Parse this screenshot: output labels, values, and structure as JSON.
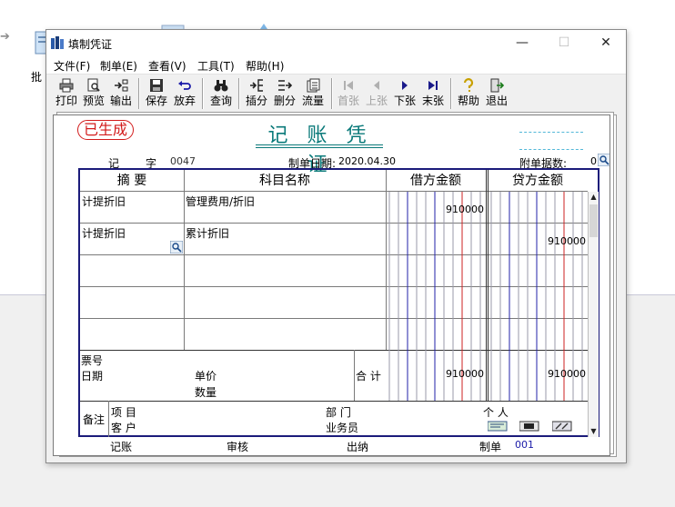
{
  "desktop": {
    "side_label": "批"
  },
  "window": {
    "title": "填制凭证",
    "controls": {
      "minimize": "—",
      "maximize": "☐",
      "close": "✕"
    }
  },
  "menu": [
    {
      "id": "file",
      "label": "文件(F)"
    },
    {
      "id": "make",
      "label": "制单(E)"
    },
    {
      "id": "view",
      "label": "查看(V)"
    },
    {
      "id": "tools",
      "label": "工具(T)"
    },
    {
      "id": "help",
      "label": "帮助(H)"
    }
  ],
  "toolbar": [
    {
      "id": "print",
      "label": "打印",
      "icon": "printer-icon",
      "enabled": true
    },
    {
      "id": "preview",
      "label": "预览",
      "icon": "preview-icon",
      "enabled": true
    },
    {
      "id": "export",
      "label": "输出",
      "icon": "export-icon",
      "enabled": true
    },
    {
      "id": "save",
      "label": "保存",
      "icon": "save-icon",
      "enabled": true
    },
    {
      "id": "discard",
      "label": "放弃",
      "icon": "undo-icon",
      "enabled": true
    },
    {
      "id": "query",
      "label": "查询",
      "icon": "binoculars-icon",
      "enabled": true
    },
    {
      "id": "insert",
      "label": "插分",
      "icon": "insert-row-icon",
      "enabled": true
    },
    {
      "id": "delete",
      "label": "删分",
      "icon": "delete-row-icon",
      "enabled": true
    },
    {
      "id": "flow",
      "label": "流量",
      "icon": "flow-icon",
      "enabled": true
    },
    {
      "id": "first",
      "label": "首张",
      "icon": "first-icon",
      "enabled": false
    },
    {
      "id": "prev",
      "label": "上张",
      "icon": "prev-icon",
      "enabled": false
    },
    {
      "id": "next",
      "label": "下张",
      "icon": "next-icon",
      "enabled": true
    },
    {
      "id": "last",
      "label": "末张",
      "icon": "last-icon",
      "enabled": true
    },
    {
      "id": "help",
      "label": "帮助",
      "icon": "help-icon",
      "enabled": true
    },
    {
      "id": "exit",
      "label": "退出",
      "icon": "exit-icon",
      "enabled": true
    }
  ],
  "voucher": {
    "stamp": "已生成",
    "title": "记 账 凭 证",
    "type": "记",
    "word_label": "字",
    "number": "0047",
    "date_label": "制单日期:",
    "date": "2020.04.30",
    "attachments_label": "附单据数:",
    "attachments": "0",
    "headers": {
      "summary": "摘 要",
      "account": "科目名称",
      "debit": "借方金额",
      "credit": "贷方金额"
    },
    "entries": [
      {
        "summary": "计提折旧",
        "account": "管理费用/折旧",
        "debit": "910000",
        "credit": ""
      },
      {
        "summary": "计提折旧",
        "account": "累计折旧",
        "debit": "",
        "credit": "910000"
      },
      {
        "summary": "",
        "account": "",
        "debit": "",
        "credit": ""
      },
      {
        "summary": "",
        "account": "",
        "debit": "",
        "credit": ""
      },
      {
        "summary": "",
        "account": "",
        "debit": "",
        "credit": ""
      }
    ],
    "totals": {
      "ticket_label": "票号",
      "date_label": "日期",
      "price_label": "单价",
      "qty_label": "数量",
      "total_label": "合 计",
      "debit": "910000",
      "credit": "910000"
    },
    "remarks": {
      "label": "备注",
      "project_label": "项  目",
      "customer_label": "客  户",
      "dept_label": "部  门",
      "salesperson_label": "业务员",
      "person_label": "个  人"
    },
    "footer": {
      "bookkeeper_label": "记账",
      "reviewer_label": "审核",
      "cashier_label": "出纳",
      "maker_label": "制单",
      "maker": "001"
    }
  },
  "colors": {
    "stamp": "#d21a1a",
    "title": "#0b7a7a",
    "grid_border": "#1b1b7a",
    "amount_blue_line": "#2222aa",
    "amount_red_line": "#cc2222",
    "maker_code": "#1a1aa8"
  }
}
